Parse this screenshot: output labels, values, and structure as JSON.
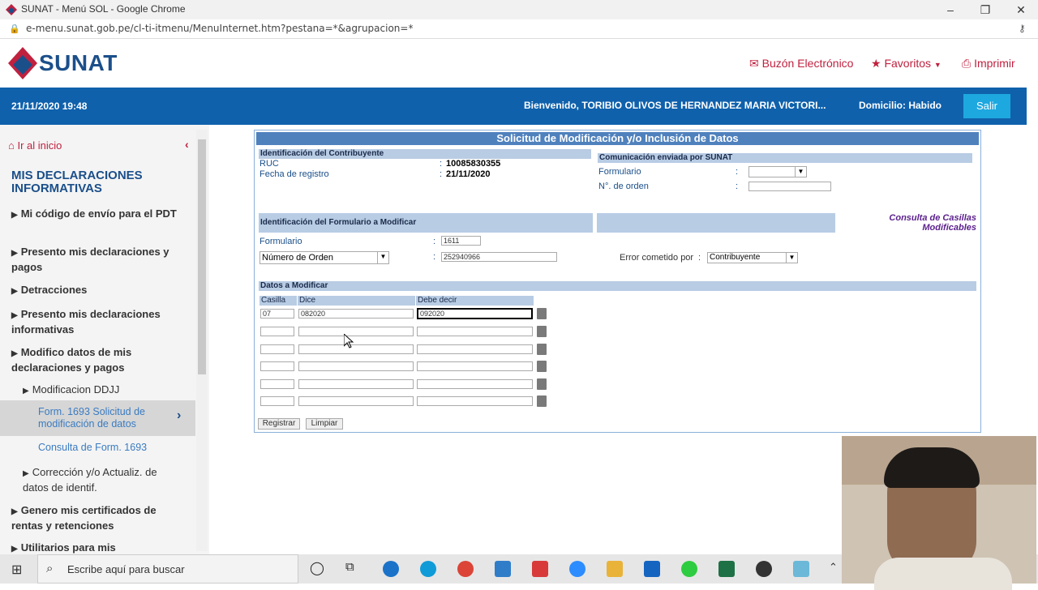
{
  "window": {
    "title": "SUNAT - Menú SOL - Google Chrome",
    "url": "e-menu.sunat.gob.pe/cl-ti-itmenu/MenuInternet.htm?pestana=*&agrupacion=*"
  },
  "brand": {
    "name": "SUNAT",
    "links": [
      "Buzón Electrónico",
      "Favoritos",
      "Imprimir"
    ]
  },
  "bar": {
    "datetime": "21/11/2020 19:48",
    "welcome": "Bienvenido, TORIBIO OLIVOS DE HERNANDEZ MARIA VICTORI...",
    "domicilio": "Domicilio: Habido",
    "salir": "Salir"
  },
  "sidebar": {
    "home": "Ir al inicio",
    "section": "MIS DECLARACIONES INFORMATIVAS",
    "items": [
      "Mi código de envío para el PDT",
      "Presento mis declaraciones y pagos",
      "Detracciones",
      "Presento mis declaraciones informativas",
      "Modifico datos de mis declaraciones y pagos",
      "Modificacion DDJJ",
      "Form. 1693 Solicitud de modificación de datos",
      "Consulta de Form. 1693",
      "Corrección y/o Actualiz. de datos de identif.",
      "Genero mis certificados de rentas y retenciones",
      "Utilitarios para mis"
    ]
  },
  "form": {
    "title": "Solicitud de Modificación y/o Inclusión de Datos",
    "contrib_head": "Identificación del Contribuyente",
    "ruc_label": "RUC",
    "ruc": "10085830355",
    "fecha_label": "Fecha de registro",
    "fecha": "21/11/2020",
    "com_head": "Comunicación enviada por SUNAT",
    "formulario_label": "Formulario",
    "orden_label": "N°. de orden",
    "ident_head": "Identificación del Formulario a Modificar",
    "consulta": "Consulta de Casillas Modificables",
    "formulario_val": "1611",
    "numero_orden_select": "Número de Orden",
    "numero_orden_val": "252940966",
    "error_label": "Error cometido por",
    "error_val": "Contribuyente",
    "datos_head": "Datos a Modificar",
    "col_casilla": "Casilla",
    "col_dice": "Dice",
    "col_debe": "Debe decir",
    "row1": {
      "casilla": "07",
      "dice": "082020",
      "debe": "092020"
    },
    "registrar": "Registrar",
    "limpiar": "Limpiar",
    "colon": ":"
  },
  "taskbar": {
    "search": "Escribe aquí para buscar"
  }
}
